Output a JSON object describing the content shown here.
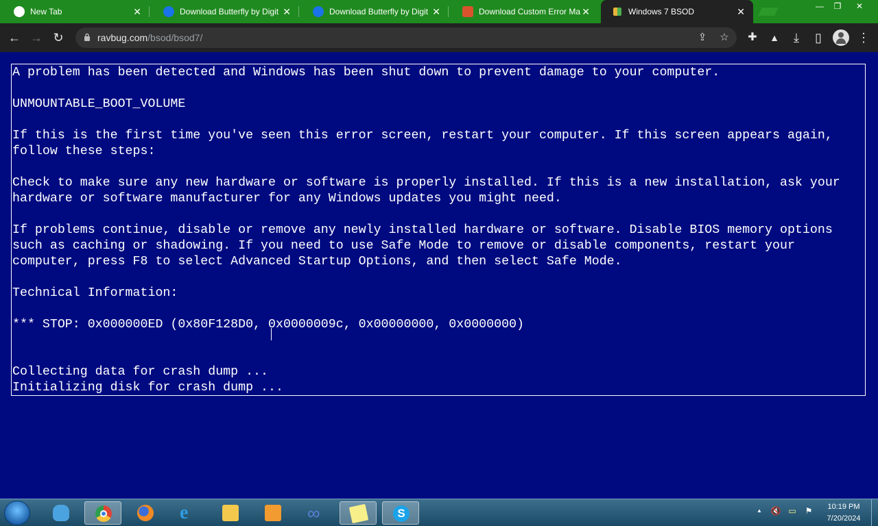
{
  "browser": {
    "tabs": [
      {
        "title": "New Tab",
        "icon": "chrome-newtab-icon",
        "color": "#ffffff",
        "active": false
      },
      {
        "title": "Download Butterfly by Digit",
        "icon": "butterfly-site-icon",
        "color": "#1a73e8",
        "active": false
      },
      {
        "title": "Download Butterfly by Digit",
        "icon": "butterfly-site-icon",
        "color": "#1a73e8",
        "active": false
      },
      {
        "title": "Download Custom Error Ma",
        "icon": "store-site-icon",
        "color": "#d9532c",
        "active": false
      },
      {
        "title": "Windows 7 BSOD",
        "icon": "windows-flag-icon",
        "color": "#e8b339",
        "active": true
      }
    ],
    "window_controls": {
      "minimize": "—",
      "restore": "❐",
      "close": "✕"
    },
    "toolbar": {
      "back": "←",
      "forward": "→",
      "reload": "↻",
      "url_host": "ravbug.com",
      "url_path": "/bsod/bsod7/",
      "share": "⇪",
      "bookmark": "☆",
      "extensions": "✚",
      "labs": "▲",
      "download": "⤓",
      "sidepanel": "▯",
      "menu": "⋮"
    }
  },
  "bsod": {
    "lines": [
      "A problem has been detected and Windows has been shut down to prevent damage to your computer.",
      "",
      "UNMOUNTABLE_BOOT_VOLUME",
      "",
      "If this is the first time you've seen this error screen, restart your computer. If this screen appears again,",
      "follow these steps:",
      "",
      "Check to make sure any new hardware or software is properly installed. If this is a new installation, ask your",
      "hardware or software manufacturer for any Windows updates you might need.",
      "",
      "If problems continue, disable or remove any newly installed hardware or software. Disable BIOS memory options",
      "such as caching or shadowing. If you need to use Safe Mode to remove or disable components, restart your",
      "computer, press F8 to select Advanced Startup Options, and then select Safe Mode.",
      "",
      "Technical Information:",
      "",
      "*** STOP: 0x000000ED (0x80F128D0, 0x0000009c, 0x00000000, 0x0000000)",
      "",
      "",
      "Collecting data for crash dump ...",
      "Initializing disk for crash dump ..."
    ],
    "background_color": "#000a80",
    "text_color": "#ffffff"
  },
  "taskbar": {
    "items": [
      {
        "name": "windows-live-messenger-icon",
        "color": "#4aa3df",
        "active": false
      },
      {
        "name": "chrome-icon",
        "color": "#e04436",
        "active": true
      },
      {
        "name": "firefox-icon",
        "color": "#f08a24",
        "active": false
      },
      {
        "name": "internet-explorer-icon",
        "color": "#2f9be0",
        "active": false
      },
      {
        "name": "file-explorer-icon",
        "color": "#f2c94c",
        "active": false
      },
      {
        "name": "media-player-icon",
        "color": "#f29b30",
        "active": false
      },
      {
        "name": "infinity-app-icon",
        "color": "#5a7fd6",
        "active": false
      },
      {
        "name": "sticky-notes-icon",
        "color": "#f7ef8a",
        "active": true
      },
      {
        "name": "skype-icon",
        "color": "#1aa3e8",
        "active": true
      }
    ],
    "tray": {
      "up_arrow": "▲",
      "volume_muted": "🔇",
      "notes": "▭",
      "flag": "⚑"
    },
    "clock": {
      "time": "10:19 PM",
      "date": "7/20/2024"
    }
  }
}
